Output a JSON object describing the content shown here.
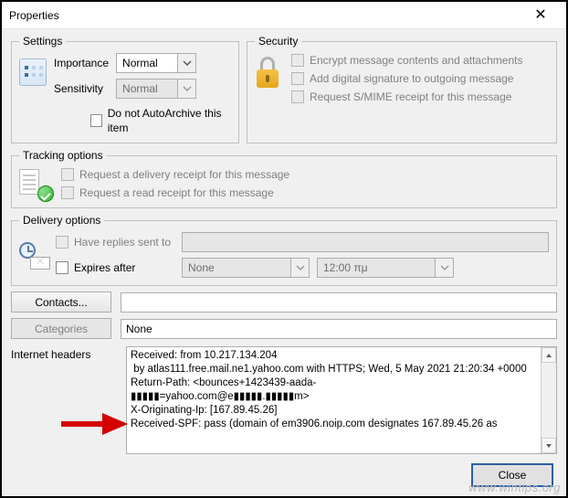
{
  "window": {
    "title": "Properties"
  },
  "settings": {
    "legend": "Settings",
    "importance_label": "Importance",
    "sensitivity_label": "Sensitivity",
    "importance_value": "Normal",
    "sensitivity_value": "Normal",
    "autoarchive_label": "Do not AutoArchive this item"
  },
  "security": {
    "legend": "Security",
    "encrypt_label": "Encrypt message contents and attachments",
    "sign_label": "Add digital signature to outgoing message",
    "smime_label": "Request S/MIME receipt for this message"
  },
  "tracking": {
    "legend": "Tracking options",
    "delivery_receipt_label": "Request a delivery receipt for this message",
    "read_receipt_label": "Request a read receipt for this message"
  },
  "delivery": {
    "legend": "Delivery options",
    "have_replies_label": "Have replies sent to",
    "expires_label": "Expires after",
    "expires_date_value": "None",
    "expires_time_value": "12:00 πμ"
  },
  "contacts_section": {
    "contacts_button": "Contacts...",
    "categories_button": "Categories",
    "categories_value": "None"
  },
  "headers": {
    "label": "Internet headers",
    "content": "Received: from 10.217.134.204\n by atlas111.free.mail.ne1.yahoo.com with HTTPS; Wed, 5 May 2021 21:20:34 +0000\nReturn-Path: <bounces+1423439-aada-\n▮▮▮▮▮=yahoo.com@e▮▮▮▮▮.▮▮▮▮▮m>\nX-Originating-Ip: [167.89.45.26]\nReceived-SPF: pass (domain of em3906.noip.com designates 167.89.45.26 as"
  },
  "footer": {
    "close": "Close"
  },
  "watermark": "www.wintips.org"
}
